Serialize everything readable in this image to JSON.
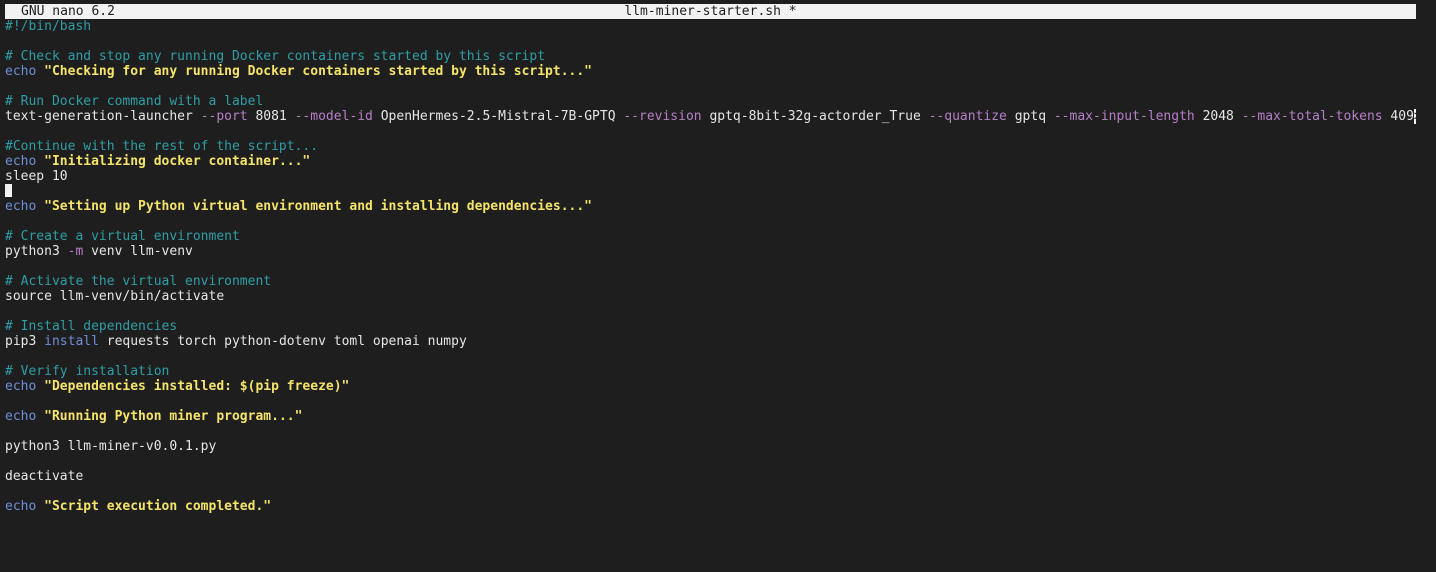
{
  "titlebar": {
    "app": "GNU nano 6.2",
    "filename": "llm-miner-starter.sh *"
  },
  "lines": [
    [
      {
        "t": "#!/bin/bash",
        "k": "comment"
      }
    ],
    [],
    [
      {
        "t": "# Check and stop any running Docker containers started by this script",
        "k": "comment"
      }
    ],
    [
      {
        "t": "echo",
        "k": "keyword"
      },
      {
        "t": " ",
        "k": "text"
      },
      {
        "t": "\"Checking for any running Docker containers started by this script...\"",
        "k": "string"
      }
    ],
    [],
    [
      {
        "t": "# Run Docker command with a label",
        "k": "comment"
      }
    ],
    [
      {
        "t": "text-generation-launcher ",
        "k": "text"
      },
      {
        "t": "--port",
        "k": "flag"
      },
      {
        "t": " 8081 ",
        "k": "text"
      },
      {
        "t": "--model-id",
        "k": "flag"
      },
      {
        "t": " OpenHermes-2.5-Mistral-7B-GPTQ ",
        "k": "text"
      },
      {
        "t": "--revision",
        "k": "flag"
      },
      {
        "t": " gptq-8bit-32g-actorder_True ",
        "k": "text"
      },
      {
        "t": "--quantize",
        "k": "flag"
      },
      {
        "t": " gptq ",
        "k": "text"
      },
      {
        "t": "--max-input-length",
        "k": "flag"
      },
      {
        "t": " 2048 ",
        "k": "text"
      },
      {
        "t": "--max-total-tokens",
        "k": "flag"
      },
      {
        "t": " 409",
        "k": "text"
      },
      {
        "t": ">",
        "k": "overflow"
      }
    ],
    [],
    [
      {
        "t": "#Continue with the rest of the script...",
        "k": "comment"
      }
    ],
    [
      {
        "t": "echo",
        "k": "keyword"
      },
      {
        "t": " ",
        "k": "text"
      },
      {
        "t": "\"Initializing docker container...\"",
        "k": "string"
      }
    ],
    [
      {
        "t": "sleep 10",
        "k": "text"
      }
    ],
    [
      {
        "t": "",
        "k": "cursor"
      }
    ],
    [
      {
        "t": "echo",
        "k": "keyword"
      },
      {
        "t": " ",
        "k": "text"
      },
      {
        "t": "\"Setting up Python virtual environment and installing dependencies...\"",
        "k": "string"
      }
    ],
    [],
    [
      {
        "t": "# Create a virtual environment",
        "k": "comment"
      }
    ],
    [
      {
        "t": "python3 ",
        "k": "text"
      },
      {
        "t": "-m",
        "k": "flag"
      },
      {
        "t": " venv llm-venv",
        "k": "text"
      }
    ],
    [],
    [
      {
        "t": "# Activate the virtual environment",
        "k": "comment"
      }
    ],
    [
      {
        "t": "source llm-venv/bin/activate",
        "k": "text"
      }
    ],
    [],
    [
      {
        "t": "# Install dependencies",
        "k": "comment"
      }
    ],
    [
      {
        "t": "pip3 ",
        "k": "text"
      },
      {
        "t": "install",
        "k": "keyword"
      },
      {
        "t": " requests torch python-dotenv toml openai numpy",
        "k": "text"
      }
    ],
    [],
    [
      {
        "t": "# Verify installation",
        "k": "comment"
      }
    ],
    [
      {
        "t": "echo",
        "k": "keyword"
      },
      {
        "t": " ",
        "k": "text"
      },
      {
        "t": "\"Dependencies installed: $(pip freeze)\"",
        "k": "string"
      }
    ],
    [],
    [
      {
        "t": "echo",
        "k": "keyword"
      },
      {
        "t": " ",
        "k": "text"
      },
      {
        "t": "\"Running Python miner program...\"",
        "k": "string"
      }
    ],
    [],
    [
      {
        "t": "python3 llm-miner-v0.0.1.py",
        "k": "text"
      }
    ],
    [],
    [
      {
        "t": "deactivate",
        "k": "text"
      }
    ],
    [],
    [
      {
        "t": "echo",
        "k": "keyword"
      },
      {
        "t": " ",
        "k": "text"
      },
      {
        "t": "\"Script execution completed.\"",
        "k": "string"
      }
    ]
  ]
}
